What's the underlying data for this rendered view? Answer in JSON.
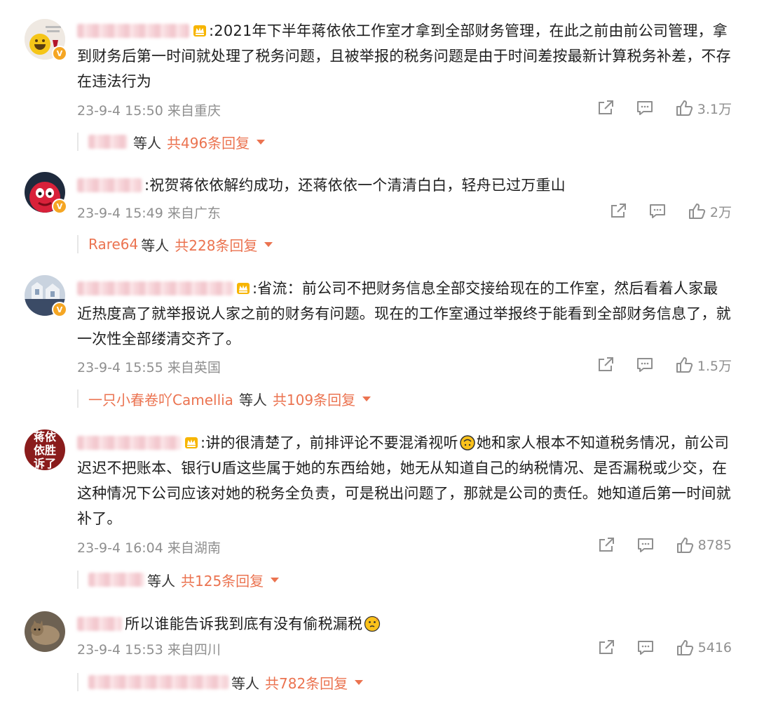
{
  "comments": [
    {
      "text": ":2021年下半年蒋依依工作室才拿到全部财务管理，在此之前由前公司管理，拿到财务后第一时间就处理了税务问题，且被举报的税务问题是由于时间差按最新计算税务补差，不存在违法行为",
      "time": "23-9-4 15:50 来自重庆",
      "likes": "3.1万",
      "reply_user": "",
      "reply_suffix": "等人",
      "reply_count": "共496条回复"
    },
    {
      "text": ":祝贺蒋依依解约成功，还蒋依依一个清清白白，轻舟已过万重山",
      "time": "23-9-4 15:49 来自广东",
      "likes": "2万",
      "reply_user": "Rare64",
      "reply_suffix": "等人",
      "reply_count": "共228条回复"
    },
    {
      "text": ":省流：前公司不把财务信息全部交接给现在的工作室，然后看着人家最近热度高了就举报说人家之前的财务有问题。现在的工作室通过举报终于能看到全部财务信息了，就一次性全部缕清交齐了。",
      "time": "23-9-4 15:55 来自英国",
      "likes": "1.5万",
      "reply_user": "一只小春卷吖Camellia",
      "reply_suffix": "等人",
      "reply_count": "共109条回复"
    },
    {
      "text_a": ":讲的很清楚了，前排评论不要混淆视听",
      "text_b": "她和家人根本不知道税务情况，前公司迟迟不把账本、银行U盾这些属于她的东西给她，她无从知道自己的纳税情况、是否漏税或少交，在这种情况下公司应该对她的税务全负责，可是税出问题了，那就是公司的责任。她知道后第一时间就补了。",
      "avatar_text": "蒋依依胜诉了",
      "time": "23-9-4 16:04 来自湖南",
      "likes": "8785",
      "reply_user": "",
      "reply_suffix": "等人",
      "reply_count": "共125条回复"
    },
    {
      "text": "所以谁能告诉我到底有没有偷税漏税",
      "time": "23-9-4 15:53 来自四川",
      "likes": "5416",
      "reply_user": "",
      "reply_suffix": "等人",
      "reply_count": "共782条回复"
    }
  ],
  "colors": {
    "accent": "#eb7350",
    "meta": "#8f8f8f"
  },
  "icons": [
    "share-icon",
    "comment-icon",
    "like-icon",
    "crown-icon",
    "verified-badge-icon"
  ]
}
